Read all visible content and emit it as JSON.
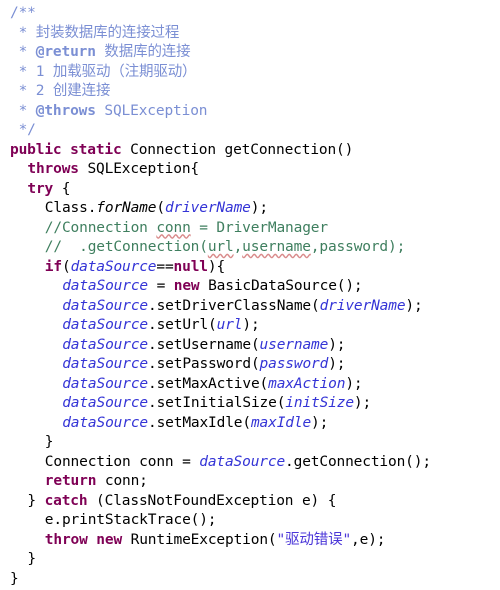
{
  "editor": {
    "language": "Java",
    "file_type": "java-source",
    "background": "#ffffff",
    "colors": {
      "keyword": "#7f0055",
      "javadoc": "#7b8fd4",
      "line_comment": "#3f7f5f",
      "field": "#3434d6",
      "string": "#4a36d8",
      "default_text": "#000000",
      "typo_underline": "#d98b8b"
    },
    "lines": [
      {
        "n": 1,
        "indent": 0,
        "tokens": [
          {
            "t": "/**",
            "c": "doc"
          }
        ]
      },
      {
        "n": 2,
        "indent": 0,
        "tokens": [
          {
            "t": " * ",
            "c": "doc"
          },
          {
            "t": "封装数据库的连接过程",
            "c": "doc"
          }
        ]
      },
      {
        "n": 3,
        "indent": 0,
        "tokens": [
          {
            "t": " * ",
            "c": "doc"
          },
          {
            "t": "@return",
            "c": "doctag"
          },
          {
            "t": " 数据库的连接",
            "c": "doc"
          }
        ]
      },
      {
        "n": 4,
        "indent": 0,
        "tokens": [
          {
            "t": " * ",
            "c": "doc"
          },
          {
            "t": "1 加载驱动（注期驱动）",
            "c": "doc"
          }
        ]
      },
      {
        "n": 5,
        "indent": 0,
        "tokens": [
          {
            "t": " * ",
            "c": "doc"
          },
          {
            "t": "2 创建连接",
            "c": "doc"
          }
        ]
      },
      {
        "n": 6,
        "indent": 0,
        "tokens": [
          {
            "t": " * ",
            "c": "doc"
          },
          {
            "t": "@throws",
            "c": "doctag"
          },
          {
            "t": " SQLException",
            "c": "doc"
          }
        ]
      },
      {
        "n": 7,
        "indent": 0,
        "tokens": [
          {
            "t": " */",
            "c": "doc"
          }
        ]
      },
      {
        "n": 8,
        "indent": 0,
        "tokens": [
          {
            "t": "public",
            "c": "keyword"
          },
          {
            "t": " ",
            "c": "default"
          },
          {
            "t": "static",
            "c": "keyword"
          },
          {
            "t": " Connection getConnection()",
            "c": "default"
          }
        ]
      },
      {
        "n": 9,
        "indent": 1,
        "tokens": [
          {
            "t": "throws",
            "c": "keyword"
          },
          {
            "t": " SQLException{",
            "c": "default"
          }
        ]
      },
      {
        "n": 10,
        "indent": 1,
        "tokens": [
          {
            "t": "try",
            "c": "keyword"
          },
          {
            "t": " {",
            "c": "default"
          }
        ]
      },
      {
        "n": 11,
        "indent": 2,
        "tokens": [
          {
            "t": "Class.",
            "c": "default"
          },
          {
            "t": "forName",
            "c": "static"
          },
          {
            "t": "(",
            "c": "default"
          },
          {
            "t": "driverName",
            "c": "field"
          },
          {
            "t": ");",
            "c": "default"
          }
        ]
      },
      {
        "n": 12,
        "indent": 2,
        "tokens": [
          {
            "t": "//Connection ",
            "c": "comment"
          },
          {
            "t": "conn",
            "c": "comment",
            "typo": true
          },
          {
            "t": " = DriverManager",
            "c": "comment"
          }
        ]
      },
      {
        "n": 13,
        "indent": 2,
        "tokens": [
          {
            "t": "//  .getConnection(",
            "c": "comment"
          },
          {
            "t": "url",
            "c": "comment",
            "typo": true
          },
          {
            "t": ",",
            "c": "comment"
          },
          {
            "t": "username",
            "c": "comment",
            "typo": true
          },
          {
            "t": ",password);",
            "c": "comment"
          }
        ]
      },
      {
        "n": 14,
        "indent": 2,
        "tokens": [
          {
            "t": "if",
            "c": "keyword"
          },
          {
            "t": "(",
            "c": "default"
          },
          {
            "t": "dataSource",
            "c": "field"
          },
          {
            "t": "==",
            "c": "default"
          },
          {
            "t": "null",
            "c": "keyword"
          },
          {
            "t": "){",
            "c": "default"
          }
        ]
      },
      {
        "n": 15,
        "indent": 3,
        "tokens": [
          {
            "t": "dataSource",
            "c": "field"
          },
          {
            "t": " = ",
            "c": "default"
          },
          {
            "t": "new",
            "c": "keyword"
          },
          {
            "t": " BasicDataSource();",
            "c": "default"
          }
        ]
      },
      {
        "n": 16,
        "indent": 3,
        "tokens": [
          {
            "t": "dataSource",
            "c": "field"
          },
          {
            "t": ".setDriverClassName(",
            "c": "default"
          },
          {
            "t": "driverName",
            "c": "field"
          },
          {
            "t": ");",
            "c": "default"
          }
        ]
      },
      {
        "n": 17,
        "indent": 3,
        "tokens": [
          {
            "t": "dataSource",
            "c": "field"
          },
          {
            "t": ".setUrl(",
            "c": "default"
          },
          {
            "t": "url",
            "c": "field"
          },
          {
            "t": ");",
            "c": "default"
          }
        ]
      },
      {
        "n": 18,
        "indent": 3,
        "tokens": [
          {
            "t": "dataSource",
            "c": "field"
          },
          {
            "t": ".setUsername(",
            "c": "default"
          },
          {
            "t": "username",
            "c": "field"
          },
          {
            "t": ");",
            "c": "default"
          }
        ]
      },
      {
        "n": 19,
        "indent": 3,
        "tokens": [
          {
            "t": "dataSource",
            "c": "field"
          },
          {
            "t": ".setPassword(",
            "c": "default"
          },
          {
            "t": "password",
            "c": "field"
          },
          {
            "t": ");",
            "c": "default"
          }
        ]
      },
      {
        "n": 20,
        "indent": 3,
        "tokens": [
          {
            "t": "dataSource",
            "c": "field"
          },
          {
            "t": ".setMaxActive(",
            "c": "default"
          },
          {
            "t": "maxAction",
            "c": "field"
          },
          {
            "t": ");",
            "c": "default"
          }
        ]
      },
      {
        "n": 21,
        "indent": 3,
        "tokens": [
          {
            "t": "dataSource",
            "c": "field"
          },
          {
            "t": ".setInitialSize(",
            "c": "default"
          },
          {
            "t": "initSize",
            "c": "field"
          },
          {
            "t": ");",
            "c": "default"
          }
        ]
      },
      {
        "n": 22,
        "indent": 3,
        "tokens": [
          {
            "t": "dataSource",
            "c": "field"
          },
          {
            "t": ".setMaxIdle(",
            "c": "default"
          },
          {
            "t": "maxIdle",
            "c": "field"
          },
          {
            "t": ");",
            "c": "default"
          }
        ]
      },
      {
        "n": 23,
        "indent": 2,
        "tokens": [
          {
            "t": "}",
            "c": "default"
          }
        ]
      },
      {
        "n": 24,
        "indent": 2,
        "tokens": [
          {
            "t": "Connection conn = ",
            "c": "default"
          },
          {
            "t": "dataSource",
            "c": "field"
          },
          {
            "t": ".getConnection();",
            "c": "default"
          }
        ]
      },
      {
        "n": 25,
        "indent": 2,
        "tokens": [
          {
            "t": "return",
            "c": "keyword"
          },
          {
            "t": " conn;",
            "c": "default"
          }
        ]
      },
      {
        "n": 26,
        "indent": 1,
        "tokens": [
          {
            "t": "} ",
            "c": "default"
          },
          {
            "t": "catch",
            "c": "keyword"
          },
          {
            "t": " (ClassNotFoundException e) {",
            "c": "default"
          }
        ]
      },
      {
        "n": 27,
        "indent": 2,
        "tokens": [
          {
            "t": "e.printStackTrace();",
            "c": "default"
          }
        ]
      },
      {
        "n": 28,
        "indent": 2,
        "tokens": [
          {
            "t": "throw",
            "c": "keyword"
          },
          {
            "t": " ",
            "c": "default"
          },
          {
            "t": "new",
            "c": "keyword"
          },
          {
            "t": " RuntimeException(",
            "c": "default"
          },
          {
            "t": "\"驱动错误\"",
            "c": "string"
          },
          {
            "t": ",e);",
            "c": "default"
          }
        ]
      },
      {
        "n": 29,
        "indent": 1,
        "tokens": [
          {
            "t": "}",
            "c": "default"
          }
        ]
      },
      {
        "n": 30,
        "indent": 0,
        "tokens": [
          {
            "t": "}",
            "c": "default"
          }
        ]
      }
    ]
  }
}
